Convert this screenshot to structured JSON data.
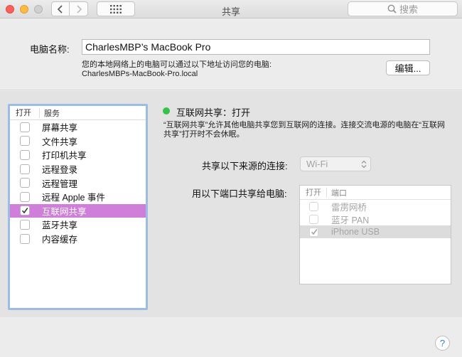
{
  "window": {
    "title": "共享"
  },
  "toolbar": {
    "search_placeholder": "搜索"
  },
  "computer_name": {
    "label": "电脑名称:",
    "value": "CharlesMBP’s MacBook Pro",
    "local_desc_line1": "您的本地网络上的电脑可以通过以下地址访问您的电脑:",
    "local_desc_line2": "CharlesMBPs-MacBook-Pro.local",
    "edit_label": "编辑..."
  },
  "services": {
    "col_open": "打开",
    "col_service": "服务",
    "items": [
      {
        "label": "屏幕共享",
        "checked": false,
        "selected": false
      },
      {
        "label": "文件共享",
        "checked": false,
        "selected": false
      },
      {
        "label": "打印机共享",
        "checked": false,
        "selected": false
      },
      {
        "label": "远程登录",
        "checked": false,
        "selected": false
      },
      {
        "label": "远程管理",
        "checked": false,
        "selected": false
      },
      {
        "label": "远程 Apple 事件",
        "checked": false,
        "selected": false
      },
      {
        "label": "互联网共享",
        "checked": true,
        "selected": true
      },
      {
        "label": "蓝牙共享",
        "checked": false,
        "selected": false
      },
      {
        "label": "内容缓存",
        "checked": false,
        "selected": false
      }
    ]
  },
  "detail": {
    "status": "互联网共享：打开",
    "status_color": "#35c24a",
    "description": "“互联网共享”允许其他电脑共享您到互联网的连接。连接交流电源的电脑在“互联网共享”打开时不会休眠。",
    "from_label": "共享以下来源的连接:",
    "from_value": "Wi-Fi",
    "to_label": "用以下端口共享给电脑:",
    "ports_col_open": "打开",
    "ports_col_port": "端口",
    "ports": [
      {
        "label": "雷雳网桥",
        "checked": false,
        "selected": false
      },
      {
        "label": "蓝牙 PAN",
        "checked": false,
        "selected": false
      },
      {
        "label": "iPhone USB",
        "checked": true,
        "selected": true
      }
    ]
  },
  "help_label": "?",
  "colors": {
    "selection": "#cf7fd9",
    "focus_ring": "#9cbbe5"
  }
}
